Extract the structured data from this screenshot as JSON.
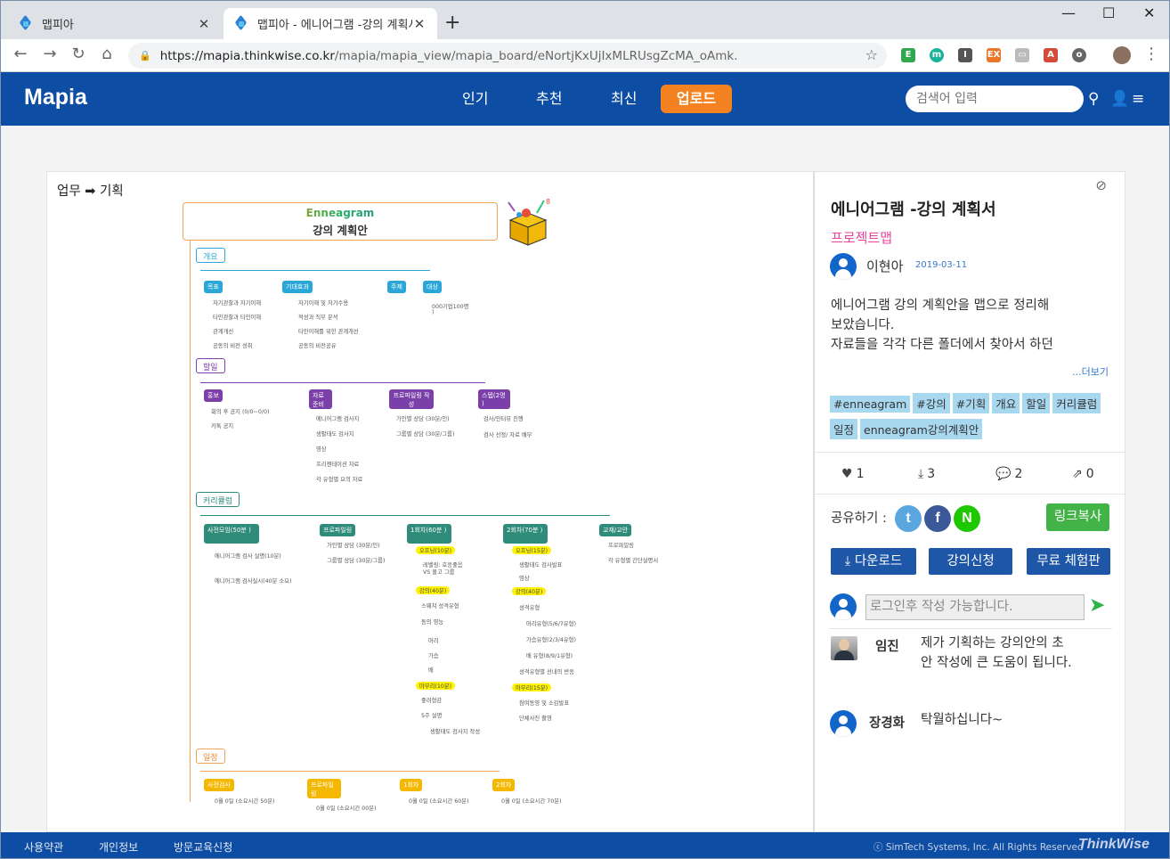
{
  "browser": {
    "tabs": [
      {
        "title": "맵피아",
        "close": "✕"
      },
      {
        "title": "맵피아 - 에니어그램 -강의 계획서",
        "close": "✕"
      }
    ],
    "new_tab": "+",
    "window_controls": {
      "minimize": "—",
      "maximize": "☐",
      "close": "✕"
    },
    "url_host": "https://mapia.thinkwise.co.kr",
    "url_path": "/mapia/mapia_view/mapia_board/eNortjKxUjIxMLRUsgZcMA_oAmk."
  },
  "header": {
    "logo": "Mapia",
    "nav": [
      "인기",
      "추천",
      "최신"
    ],
    "upload": "업로드",
    "search_placeholder": "검색어 입력"
  },
  "breadcrumb": "업무 ➡ 기획",
  "mindmap": {
    "title_line1": "Enneagram",
    "title_line2": "강의 계획안",
    "sections": [
      {
        "label": "개요",
        "color": "#2aa7d8"
      },
      {
        "label": "할일",
        "color": "#7b3fa9"
      },
      {
        "label": "커리큘럼",
        "color": "#2f8b7a"
      },
      {
        "label": "일정",
        "color": "#f0a55a"
      }
    ],
    "overview_nodes": [
      "목표",
      "기대효과",
      "주제",
      "대상"
    ],
    "overview_leaves": {
      "goal": [
        "자기관찰과 자기이해",
        "타인관찰과 타인이해",
        "관계개선",
        "공동의 비전 성취"
      ],
      "effect": [
        "자기이해 및 자기수용",
        "적성과 직무 분석",
        "타인이해를 위한 관계개선",
        "공동의 비전공유"
      ],
      "target": [
        "000기업100명",
        ")"
      ]
    },
    "todo_nodes": [
      "홍보",
      "자료 준비",
      "프로파일링 작성",
      "스텝(2명 )"
    ],
    "todo_leaves": {
      "promo": [
        "회의 후 공지 (0/0~0/0)",
        "카톡 공지"
      ],
      "material": [
        "에니어그램 검사지",
        "생활태도 검사지",
        "영상",
        "프리젠테이션 자료",
        "각 유형별 요의 자료"
      ],
      "profile": [
        "가인별 상담 (30분/인)",
        "그룹별 상담 (30분/그룹)"
      ],
      "staff": [
        "검사/인터뷰 진행",
        "검사 선정/ 자료 배부"
      ]
    },
    "curri_nodes": [
      "사전모임(50분 )",
      "프로파일링",
      "1회차(60분 )",
      "2회차(70분 )",
      "교재/교안"
    ],
    "curri_leaves": {
      "pre": [
        "에니어그램 검사 설명(10분)",
        "에니어그램 검사실시(40분 소요)"
      ],
      "profile": [
        "가인별 상담 (30분/인)",
        "그룹별 상담 (30분/그룹)"
      ],
      "r1_hl": [
        "오프닝(10분)",
        "강의(40분)",
        "마무리(10분)"
      ],
      "r1": [
        "레벨링: 호응좋음",
        "VS 몰고 그룹",
        "스웨쳐 성격유형",
        "동의 영능",
        "머리",
        "가슴",
        "배",
        "좋려형감",
        "5주 설명",
        "생활태도 검사지 작성"
      ],
      "r2_hl": [
        "오프닝(15분)",
        "강의(40분)",
        "마무리(15분)"
      ],
      "r2": [
        "생활태도 검사발표",
        "영상",
        "성격유형",
        "머리유형(5/6/7유형)",
        "가슴유형(2/3/4유형)",
        "배 유형(8/9/1유형)",
        "성격유형별 선내의 반응",
        "참여동영 및 소감발표",
        "단체사진 촬영"
      ],
      "book": [
        "프로파일링",
        "각 유형별 간단설명서"
      ]
    },
    "schedule_nodes": [
      "사전검사",
      "프로파일링",
      "1회차",
      "2회차"
    ],
    "schedule_leaves": [
      "0월 0일 (소요시간 50분)",
      "0월 0일 (소요시간 00분)",
      "0월 0일 (소요시간 60분)",
      "0월 0일 (소요시간 70분)"
    ]
  },
  "side": {
    "title": "에니어그램 -강의 계획서",
    "type": "프로젝트맵",
    "author": "이현아",
    "date": "2019-03-11",
    "description_lines": [
      "에니어그램 강의 계획안을 맵으로 정리해",
      "보았습니다.",
      "자료들을 각각 다른 폴더에서 찾아서 하던"
    ],
    "more": "...더보기",
    "tags": [
      "#enneagram",
      "#강의",
      "#기획",
      "개요",
      "할일",
      "커리큘럼",
      "일정",
      "enneagram강의계획안"
    ],
    "stats": {
      "likes": "1",
      "downloads": "3",
      "comments": "2",
      "shares": "0"
    },
    "share_label": "공유하기 :",
    "share_icons": {
      "twitter": "t",
      "facebook": "f",
      "naver": "N"
    },
    "copy_link": "링크복사",
    "buttons": {
      "download": "다운로드",
      "course": "강의신청",
      "trial": "무료 체험판"
    },
    "comment_placeholder": "로그인후 작성 가능합니다.",
    "comments": [
      {
        "name": "임진",
        "text": "제가 기획하는 강의안의 초안 작성에 큰 도움이 됩니다."
      },
      {
        "name": "장경화",
        "text": "탁월하십니다~"
      }
    ]
  },
  "footer": {
    "links": [
      "사용약관",
      "개인정보",
      "방문교육신청"
    ],
    "copyright": "ⓒ SimTech Systems, Inc. All Rights Reserved",
    "brand": "ThinkWise"
  }
}
